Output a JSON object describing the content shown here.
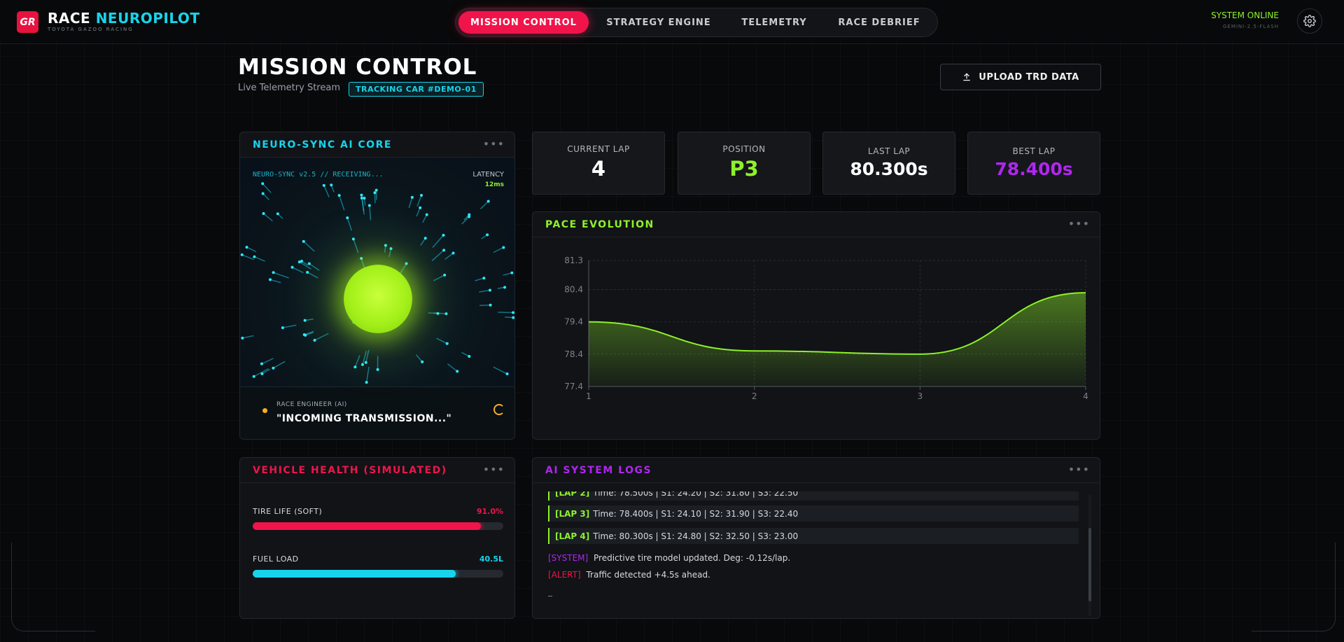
{
  "brand": {
    "badge": "GR",
    "title_main": "RACE",
    "title_accent": "NEUROPILOT",
    "subtitle": "TOYOTA GAZOO RACING"
  },
  "nav": {
    "tabs": [
      {
        "label": "MISSION CONTROL",
        "active": true
      },
      {
        "label": "STRATEGY ENGINE",
        "active": false
      },
      {
        "label": "TELEMETRY",
        "active": false
      },
      {
        "label": "RACE DEBRIEF",
        "active": false
      }
    ]
  },
  "system": {
    "status": "SYSTEM ONLINE",
    "model": "GEMINI-2.5-FLASH"
  },
  "page": {
    "title": "MISSION CONTROL",
    "subtitle": "Live Telemetry Stream",
    "tracking_badge": "TRACKING CAR #DEMO-01",
    "upload_label": "UPLOAD TRD DATA"
  },
  "neuro": {
    "title": "NEURO-SYNC AI CORE",
    "status": "NEURO-SYNC v2.5 // RECEIVING...",
    "latency_label": "LATENCY",
    "latency_value": "12ms",
    "engineer_label": "RACE ENGINEER (AI)",
    "engineer_message": "\"INCOMING TRANSMISSION...\""
  },
  "stats": [
    {
      "label": "CURRENT LAP",
      "value": "4",
      "color": "#ffffff"
    },
    {
      "label": "POSITION",
      "value": "P3",
      "color": "#8ef12a"
    },
    {
      "label": "LAST LAP",
      "value": "80.300s",
      "color": "#ffffff"
    },
    {
      "label": "BEST LAP",
      "value": "78.400s",
      "color": "#b026f0"
    }
  ],
  "pace": {
    "title": "PACE EVOLUTION"
  },
  "chart_data": {
    "type": "area",
    "title": "PACE EVOLUTION",
    "x": [
      1,
      2,
      3,
      4
    ],
    "values": [
      79.4,
      78.5,
      78.4,
      80.3
    ],
    "x_ticks": [
      "1",
      "2",
      "3",
      "4"
    ],
    "y_ticks": [
      "81.3",
      "80.4",
      "79.4",
      "78.4",
      "77.4"
    ],
    "ylim": [
      77.4,
      81.3
    ],
    "grid": true,
    "color": "#8ef12a"
  },
  "health": {
    "title": "VEHICLE HEALTH (SIMULATED)",
    "metrics": [
      {
        "label": "TIRE LIFE (SOFT)",
        "value": "91.0%",
        "fraction": 0.91,
        "color": "#f0144a"
      },
      {
        "label": "FUEL LOAD",
        "value": "40.5L",
        "fraction": 0.81,
        "color": "#17d4ec"
      }
    ]
  },
  "logs": {
    "title": "AI SYSTEM LOGS",
    "laps": [
      {
        "tag": "[LAP 2]",
        "text": "Time: 78.500s | S1: 24.20 | S2: 31.80 | S3: 22.50"
      },
      {
        "tag": "[LAP 3]",
        "text": "Time: 78.400s | S1: 24.10 | S2: 31.90 | S3: 22.40"
      },
      {
        "tag": "[LAP 4]",
        "text": "Time: 80.300s | S1: 24.80 | S2: 32.50 | S3: 23.00"
      }
    ],
    "system_tag": "[SYSTEM]",
    "system_text": "Predictive tire model updated. Deg: -0.12s/lap.",
    "alert_tag": "[ALERT]",
    "alert_text": "Traffic detected +4.5s ahead.",
    "cursor": "_"
  }
}
